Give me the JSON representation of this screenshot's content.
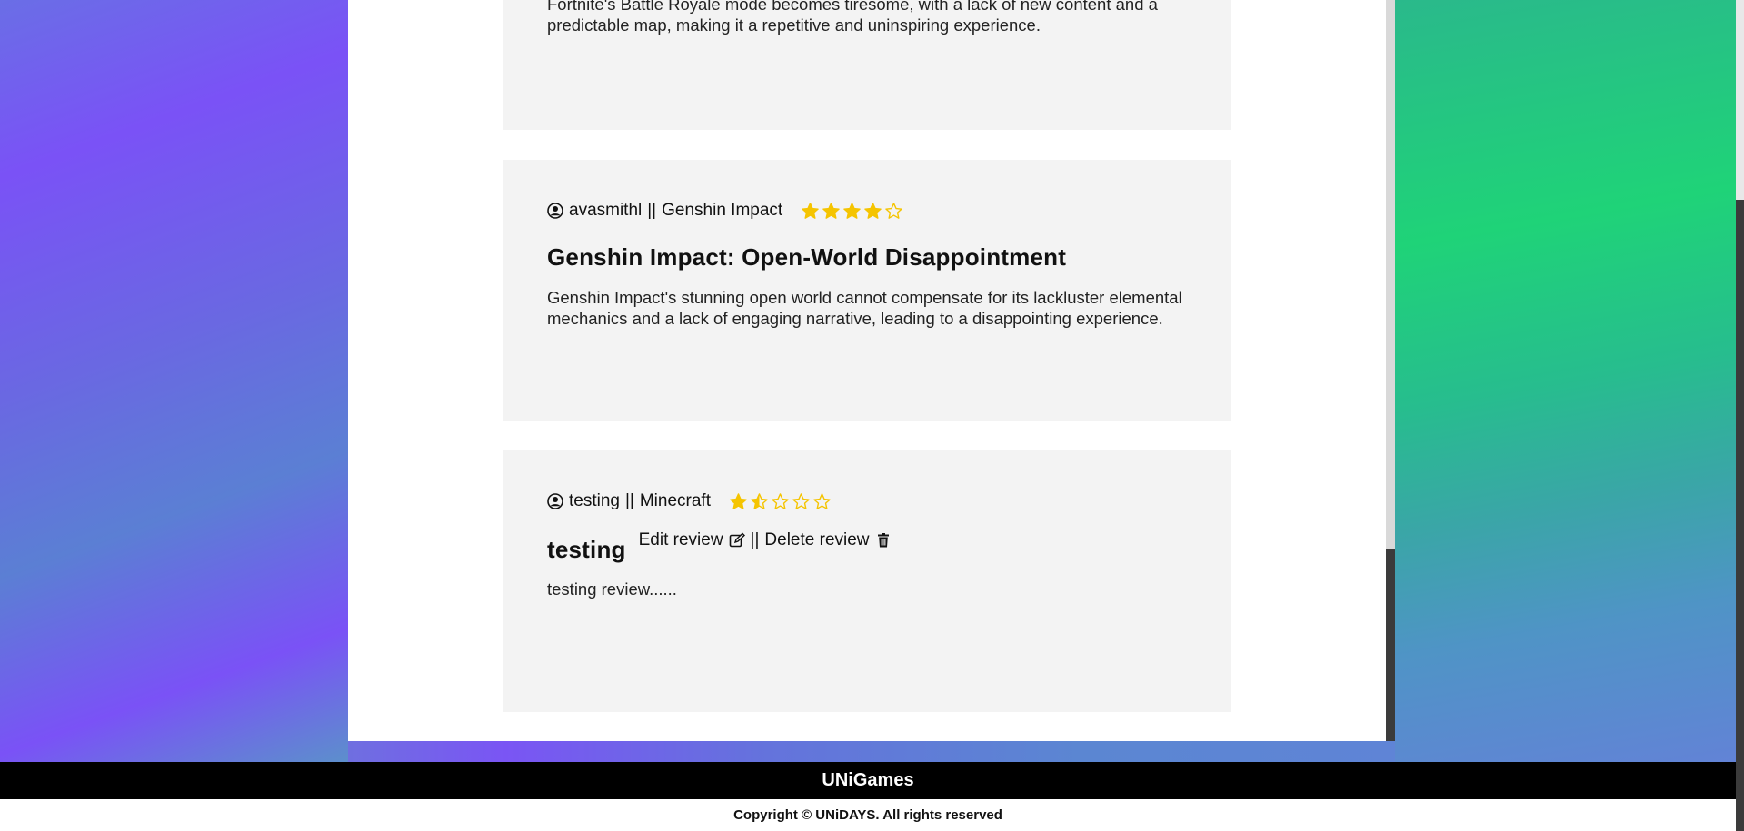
{
  "reviews": [
    {
      "body": "Fortnite's Battle Royale mode becomes tiresome, with a lack of new content and a predictable map, making it a repetitive and uninspiring experience."
    },
    {
      "username": "avasmithl",
      "separator": "||",
      "game": "Genshin Impact",
      "rating": 4,
      "rating_max": 5,
      "title": "Genshin Impact: Open-World Disappointment",
      "body": "Genshin Impact's stunning open world cannot compensate for its lackluster elemental mechanics and a lack of engaging narrative, leading to a disappointing experience."
    },
    {
      "username": "testing",
      "separator": "||",
      "game": "Minecraft",
      "rating": 1.5,
      "rating_max": 5,
      "title": "testing",
      "edit_label": "Edit review",
      "actions_separator": "||",
      "delete_label": "Delete review",
      "body": "testing review......"
    }
  ],
  "footer": {
    "brand": "UNiGames",
    "copyright": "Copyright © UNiDAYS. All rights reserved"
  },
  "icons": {
    "user": "user-circle-icon",
    "star_full": "star-filled-icon",
    "star_half": "star-half-icon",
    "star_empty": "star-outline-icon",
    "edit": "edit-icon",
    "delete": "trash-icon"
  },
  "colors": {
    "star": "#f5c400",
    "card_bg": "#f3f3f3",
    "footer_bg": "#000000"
  }
}
